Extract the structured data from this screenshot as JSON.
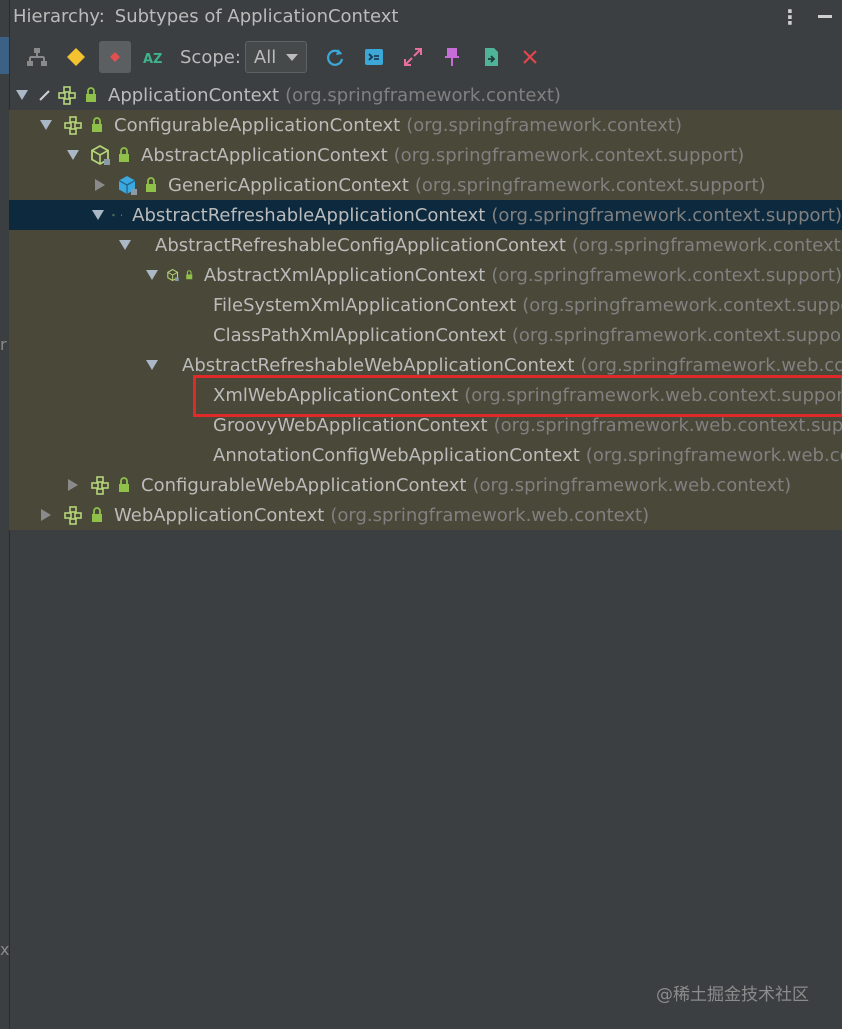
{
  "window": {
    "title_label": "Hierarchy:",
    "title": "Subtypes of ApplicationContext"
  },
  "toolbar": {
    "scope_label": "Scope:",
    "scope_value": "All",
    "buttons": [
      "class-hierarchy",
      "supertypes",
      "subtypes",
      "sort-alphabetically",
      "refresh",
      "autoscroll-to-source",
      "expand-all",
      "pin",
      "export",
      "close"
    ]
  },
  "tree": {
    "rows": [
      {
        "name": "ApplicationContext",
        "pkg": "(org.springframework.context)",
        "kind": "interface"
      },
      {
        "name": "ConfigurableApplicationContext",
        "pkg": "(org.springframework.context)",
        "kind": "interface"
      },
      {
        "name": "AbstractApplicationContext",
        "pkg": "(org.springframework.context.support)",
        "kind": "abstract-class"
      },
      {
        "name": "GenericApplicationContext",
        "pkg": "(org.springframework.context.support)",
        "kind": "class"
      },
      {
        "name": "AbstractRefreshableApplicationContext",
        "pkg": "(org.springframework.context.support)",
        "kind": "abstract-class"
      },
      {
        "name": "AbstractRefreshableConfigApplicationContext",
        "pkg": "(org.springframework.context.support)",
        "kind": "abstract-class"
      },
      {
        "name": "AbstractXmlApplicationContext",
        "pkg": "(org.springframework.context.support)",
        "kind": "abstract-class"
      },
      {
        "name": "FileSystemXmlApplicationContext",
        "pkg": "(org.springframework.context.support)",
        "kind": "class"
      },
      {
        "name": "ClassPathXmlApplicationContext",
        "pkg": "(org.springframework.context.support)",
        "kind": "class"
      },
      {
        "name": "AbstractRefreshableWebApplicationContext",
        "pkg": "(org.springframework.web.context.support)",
        "kind": "abstract-class"
      },
      {
        "name": "XmlWebApplicationContext",
        "pkg": "(org.springframework.web.context.support)",
        "kind": "class"
      },
      {
        "name": "GroovyWebApplicationContext",
        "pkg": "(org.springframework.web.context.support)",
        "kind": "class"
      },
      {
        "name": "AnnotationConfigWebApplicationContext",
        "pkg": "(org.springframework.web.context.support)",
        "kind": "class"
      },
      {
        "name": "ConfigurableWebApplicationContext",
        "pkg": "(org.springframework.web.context)",
        "kind": "interface"
      },
      {
        "name": "WebApplicationContext",
        "pkg": "(org.springframework.web.context)",
        "kind": "interface"
      }
    ]
  },
  "watermark": "@稀土掘金技术社区",
  "colors": {
    "background": "#3c3f41",
    "selection": "#0d293e",
    "highlight": "#4a4838",
    "annotation_box": "#e02a2a"
  }
}
